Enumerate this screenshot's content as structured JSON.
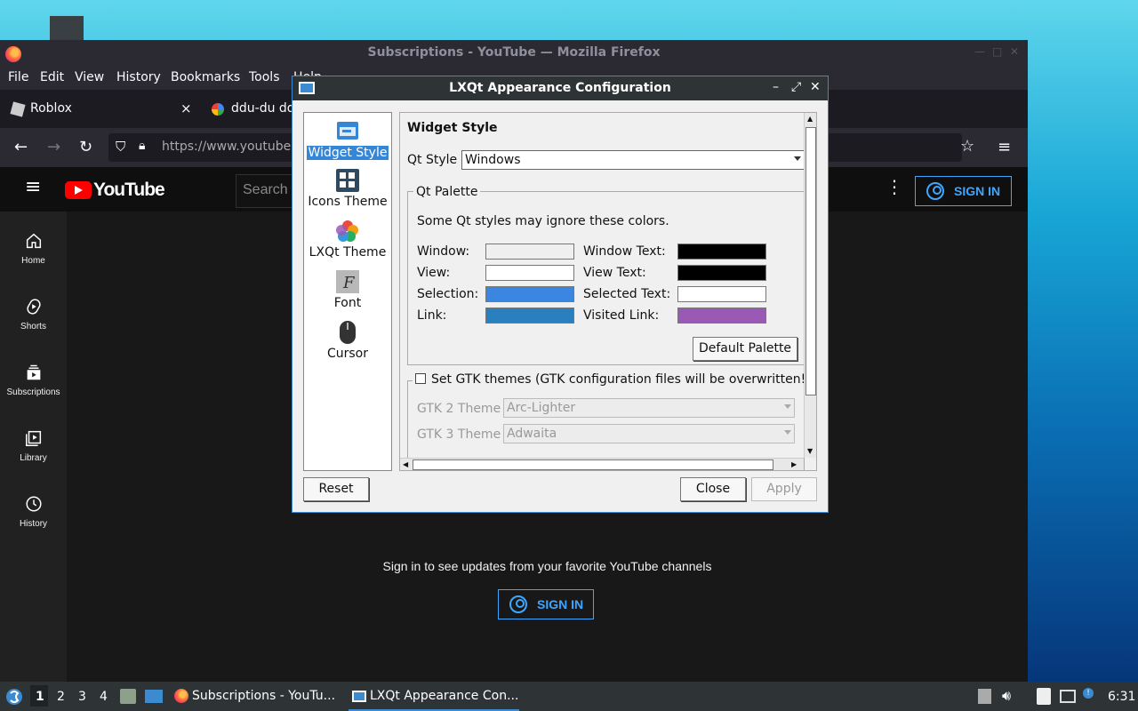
{
  "firefox": {
    "title": "Subscriptions - YouTube — Mozilla Firefox",
    "menu": [
      "File",
      "Edit",
      "View",
      "History",
      "Bookmarks",
      "Tools",
      "Help"
    ],
    "tabs": [
      {
        "label": "Roblox",
        "close": "×"
      },
      {
        "label": "ddu-du dd"
      }
    ],
    "url": "https://www.youtube"
  },
  "youtube": {
    "logo_text": "YouTube",
    "search_placeholder": "Search",
    "sign_in_label": "SIGN IN",
    "sidebar": [
      {
        "label": "Home",
        "icon": "home-icon"
      },
      {
        "label": "Shorts",
        "icon": "shorts-icon"
      },
      {
        "label": "Subscriptions",
        "icon": "subscriptions-icon"
      },
      {
        "label": "Library",
        "icon": "library-icon"
      },
      {
        "label": "History",
        "icon": "history-icon"
      }
    ],
    "signin_prompt": "Sign in to see updates from your favorite YouTube channels"
  },
  "dialog": {
    "title": "LXQt Appearance Configuration",
    "categories": [
      {
        "label": "Widget Style",
        "icon": "widget-style-icon",
        "selected": true
      },
      {
        "label": "Icons Theme",
        "icon": "icons-theme-icon"
      },
      {
        "label": "LXQt Theme",
        "icon": "lxqt-theme-icon"
      },
      {
        "label": "Font",
        "icon": "font-icon"
      },
      {
        "label": "Cursor",
        "icon": "cursor-icon"
      }
    ],
    "section_title": "Widget Style",
    "qt_style_label": "Qt Style",
    "qt_style_value": "Windows",
    "palette_group": "Qt Palette",
    "palette_note": "Some Qt styles may ignore these colors.",
    "palette": {
      "window": {
        "label": "Window:",
        "color": "#efefef"
      },
      "window_text": {
        "label": "Window Text:",
        "color": "#000000"
      },
      "view": {
        "label": "View:",
        "color": "#ffffff"
      },
      "view_text": {
        "label": "View Text:",
        "color": "#000000"
      },
      "selection": {
        "label": "Selection:",
        "color": "#3a86e0"
      },
      "selected_text": {
        "label": "Selected Text:",
        "color": "#ffffff"
      },
      "link": {
        "label": "Link:",
        "color": "#2a7fbe"
      },
      "visited_link": {
        "label": "Visited Link:",
        "color": "#9b59b6"
      }
    },
    "default_palette_button": "Default Palette",
    "gtk_checkbox_label": "Set GTK themes (GTK configuration files will be overwritten!)",
    "gtk_checked": false,
    "gtk2_label": "GTK 2 Theme",
    "gtk2_value": "Arc-Lighter",
    "gtk3_label": "GTK 3 Theme",
    "gtk3_value": "Adwaita",
    "buttons": {
      "reset": "Reset",
      "close": "Close",
      "apply": "Apply"
    }
  },
  "taskbar": {
    "workspaces": [
      "1",
      "2",
      "3",
      "4"
    ],
    "tasks": [
      {
        "label": "Subscriptions - YouTu...",
        "icon": "firefox-icon",
        "active": false
      },
      {
        "label": "LXQt Appearance Con...",
        "icon": "window-icon",
        "active": true
      }
    ],
    "clock": "6:31"
  },
  "colors": {
    "accent": "#3c8ad0",
    "youtube_blue": "#3ea6ff",
    "youtube_red": "#ff0000"
  }
}
